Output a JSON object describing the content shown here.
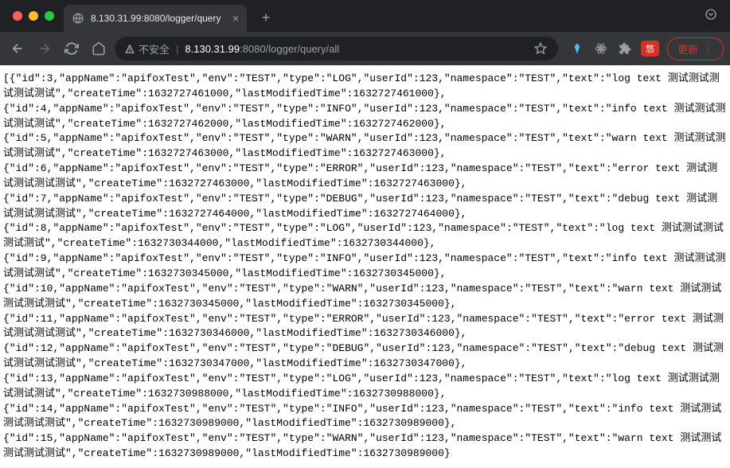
{
  "browser": {
    "tab_title": "8.130.31.99:8080/logger/query",
    "insecure_label": "不安全",
    "url_host_dim_prefix": "",
    "url_host": "8.130.31.99",
    "url_port_path": ":8080/logger/query/all",
    "update_label": "更新",
    "badge_label": "悠"
  },
  "response_prefix": "[",
  "logs": [
    {
      "id": 3,
      "appName": "apifoxTest",
      "env": "TEST",
      "type": "LOG",
      "userId": 123,
      "namespace": "TEST",
      "text": "log text 测试测试测试测试测试",
      "createTime": 1632727461000,
      "lastModifiedTime": 1632727461000
    },
    {
      "id": 4,
      "appName": "apifoxTest",
      "env": "TEST",
      "type": "INFO",
      "userId": 123,
      "namespace": "TEST",
      "text": "info text 测试测试测试测试测试",
      "createTime": 1632727462000,
      "lastModifiedTime": 1632727462000
    },
    {
      "id": 5,
      "appName": "apifoxTest",
      "env": "TEST",
      "type": "WARN",
      "userId": 123,
      "namespace": "TEST",
      "text": "warn text 测试测试测试测试测试",
      "createTime": 1632727463000,
      "lastModifiedTime": 1632727463000
    },
    {
      "id": 6,
      "appName": "apifoxTest",
      "env": "TEST",
      "type": "ERROR",
      "userId": 123,
      "namespace": "TEST",
      "text": "error text 测试测试测试测试测试",
      "createTime": 1632727463000,
      "lastModifiedTime": 1632727463000
    },
    {
      "id": 7,
      "appName": "apifoxTest",
      "env": "TEST",
      "type": "DEBUG",
      "userId": 123,
      "namespace": "TEST",
      "text": "debug text 测试测试测试测试测试",
      "createTime": 1632727464000,
      "lastModifiedTime": 1632727464000
    },
    {
      "id": 8,
      "appName": "apifoxTest",
      "env": "TEST",
      "type": "LOG",
      "userId": 123,
      "namespace": "TEST",
      "text": "log text 测试测试测试测试测试",
      "createTime": 1632730344000,
      "lastModifiedTime": 1632730344000
    },
    {
      "id": 9,
      "appName": "apifoxTest",
      "env": "TEST",
      "type": "INFO",
      "userId": 123,
      "namespace": "TEST",
      "text": "info text 测试测试测试测试测试",
      "createTime": 1632730345000,
      "lastModifiedTime": 1632730345000
    },
    {
      "id": 10,
      "appName": "apifoxTest",
      "env": "TEST",
      "type": "WARN",
      "userId": 123,
      "namespace": "TEST",
      "text": "warn text 测试测试测试测试测试",
      "createTime": 1632730345000,
      "lastModifiedTime": 1632730345000
    },
    {
      "id": 11,
      "appName": "apifoxTest",
      "env": "TEST",
      "type": "ERROR",
      "userId": 123,
      "namespace": "TEST",
      "text": "error text 测试测试测试测试测试",
      "createTime": 1632730346000,
      "lastModifiedTime": 1632730346000
    },
    {
      "id": 12,
      "appName": "apifoxTest",
      "env": "TEST",
      "type": "DEBUG",
      "userId": 123,
      "namespace": "TEST",
      "text": "debug text 测试测试测试测试测试",
      "createTime": 1632730347000,
      "lastModifiedTime": 1632730347000
    },
    {
      "id": 13,
      "appName": "apifoxTest",
      "env": "TEST",
      "type": "LOG",
      "userId": 123,
      "namespace": "TEST",
      "text": "log text 测试测试测试测试测试",
      "createTime": 1632730988000,
      "lastModifiedTime": 1632730988000
    },
    {
      "id": 14,
      "appName": "apifoxTest",
      "env": "TEST",
      "type": "INFO",
      "userId": 123,
      "namespace": "TEST",
      "text": "info text 测试测试测试测试测试",
      "createTime": 1632730989000,
      "lastModifiedTime": 1632730989000
    },
    {
      "id": 15,
      "appName": "apifoxTest",
      "env": "TEST",
      "type": "WARN",
      "userId": 123,
      "namespace": "TEST",
      "text": "warn text 测试测试测试测试测试",
      "createTime": 1632730989000,
      "lastModifiedTime": 1632730989000
    }
  ]
}
